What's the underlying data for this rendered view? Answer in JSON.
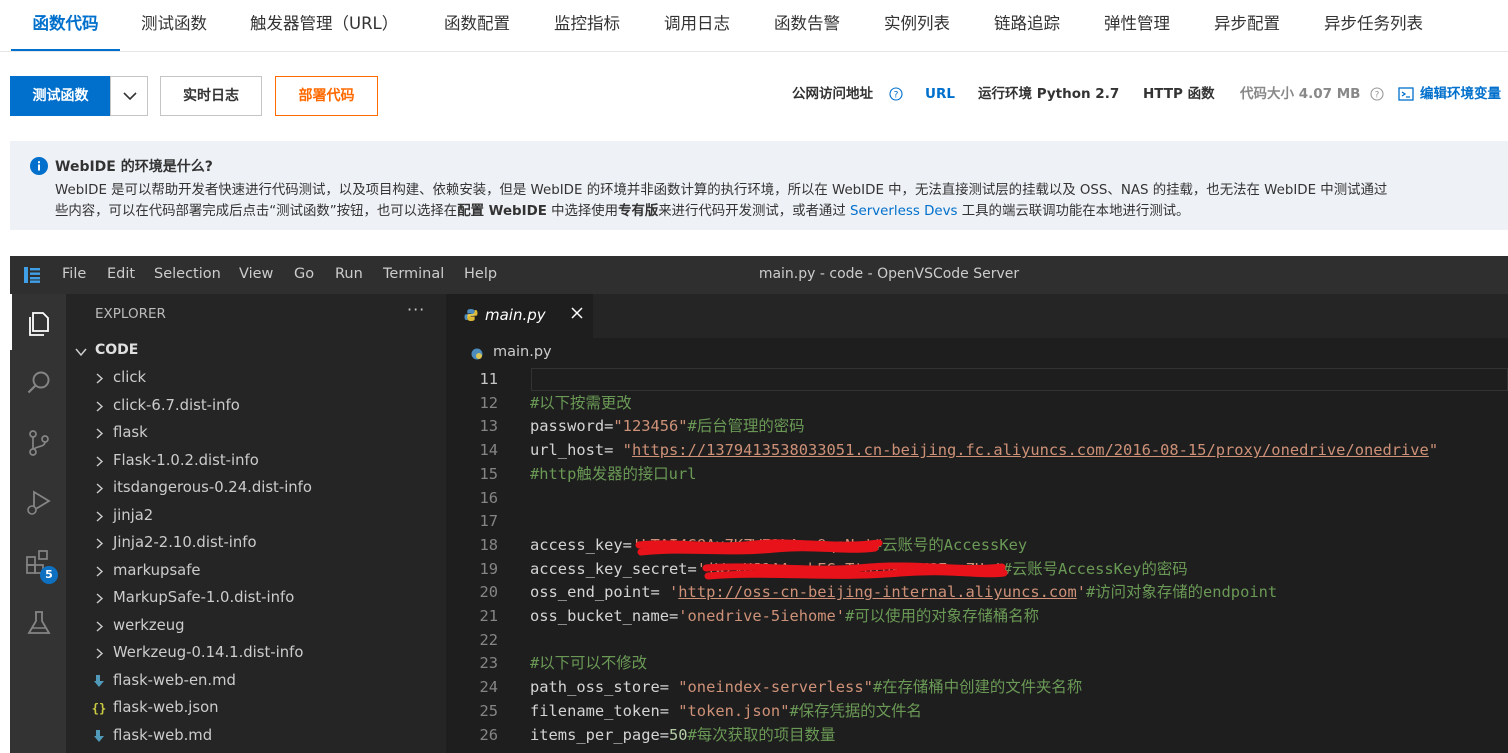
{
  "tabs": [
    {
      "label": "函数代码",
      "active": true
    },
    {
      "label": "测试函数"
    },
    {
      "label": "触发器管理（URL）"
    },
    {
      "label": "函数配置"
    },
    {
      "label": "监控指标"
    },
    {
      "label": "调用日志"
    },
    {
      "label": "函数告警"
    },
    {
      "label": "实例列表"
    },
    {
      "label": "链路追踪"
    },
    {
      "label": "弹性管理"
    },
    {
      "label": "异步配置"
    },
    {
      "label": "异步任务列表"
    }
  ],
  "toolbar": {
    "test_label": "测试函数",
    "realtime_log_label": "实时日志",
    "deploy_label": "部署代码",
    "public_url_label": "公网访问地址",
    "url_link": "URL",
    "runtime_label": "运行环境 Python 2.7",
    "http_label": "HTTP 函数",
    "code_size_label": "代码大小 4.07 MB",
    "edit_env_label": "编辑环境变量"
  },
  "notice": {
    "title": "WebIDE 的环境是什么?",
    "line1": "WebIDE 是可以帮助开发者快速进行代码测试，以及项目构建、依赖安装，但是 WebIDE 的环境并非函数计算的执行环境，所以在 WebIDE 中，无法直接测试层的挂载以及 OSS、NAS 的挂载，也无法在 WebIDE 中测试通过",
    "line2_a": "些内容，可以在代码部署完成后点击“测试函数”按钮，也可以选择在",
    "line2_b": "配置 WebIDE",
    "line2_c": " 中选择使用",
    "line2_d": "专有版",
    "line2_e": "来进行代码开发测试，或者通过 ",
    "line2_link": "Serverless Devs",
    "line2_f": " 工具的端云联调功能在本地进行测试。"
  },
  "vscode": {
    "menu": [
      "File",
      "Edit",
      "Selection",
      "View",
      "Go",
      "Run",
      "Terminal",
      "Help"
    ],
    "window_title": "main.py - code - OpenVSCode Server",
    "extensions_badge": "5",
    "explorer_title": "EXPLORER",
    "explorer_more": "···",
    "folder_name": "CODE",
    "tree": [
      {
        "label": "click",
        "type": "folder"
      },
      {
        "label": "click-6.7.dist-info",
        "type": "folder"
      },
      {
        "label": "flask",
        "type": "folder"
      },
      {
        "label": "Flask-1.0.2.dist-info",
        "type": "folder"
      },
      {
        "label": "itsdangerous-0.24.dist-info",
        "type": "folder"
      },
      {
        "label": "jinja2",
        "type": "folder"
      },
      {
        "label": "Jinja2-2.10.dist-info",
        "type": "folder"
      },
      {
        "label": "markupsafe",
        "type": "folder"
      },
      {
        "label": "MarkupSafe-1.0.dist-info",
        "type": "folder"
      },
      {
        "label": "werkzeug",
        "type": "folder"
      },
      {
        "label": "Werkzeug-0.14.1.dist-info",
        "type": "folder"
      },
      {
        "label": "flask-web-en.md",
        "type": "md"
      },
      {
        "label": "flask-web.json",
        "type": "json"
      },
      {
        "label": "flask-web.md",
        "type": "md"
      }
    ],
    "tab_name": "main.py",
    "breadcrumb": "main.py",
    "code": {
      "l11": {
        "n": "11"
      },
      "l12": {
        "n": "12",
        "comment": "#以下按需更改"
      },
      "l13": {
        "n": "13",
        "a": "password=",
        "s": "\"123456\"",
        "c": "#后台管理的密码"
      },
      "l14": {
        "n": "14",
        "a": "url_host= ",
        "q1": "\"",
        "url": "https://1379413538033051.cn-beijing.fc.aliyuncs.com/2016-08-15/proxy/onedrive/onedrive",
        "q2": "\""
      },
      "l15": {
        "n": "15",
        "comment": "#http触发器的接口url"
      },
      "l16": {
        "n": "16"
      },
      "l17": {
        "n": "17"
      },
      "l18": {
        "n": "18",
        "a": "access_key=",
        "s1": "'",
        "masked": "LTAI4G8Ax7KZWE2LAvz9qaNw",
        "s2": "'",
        "c": "#云账号的AccessKey"
      },
      "l19": {
        "n": "19",
        "a": "access_key_secret=",
        "s1": "'",
        "masked": "jWzyHJ1AAcghEGmTtqzgk3FUSFsmZUa",
        "s2": "'",
        "c": "#云账号AccessKey的密码"
      },
      "l20": {
        "n": "20",
        "a": "oss_end_point= ",
        "q1": "'",
        "url": "http://oss-cn-beijing-internal.aliyuncs.com",
        "q2": "'",
        "c": "#访问对象存储的endpoint"
      },
      "l21": {
        "n": "21",
        "a": "oss_bucket_name=",
        "s": "'onedrive-5iehome'",
        "c": "#可以使用的对象存储桶名称"
      },
      "l22": {
        "n": "22"
      },
      "l23": {
        "n": "23",
        "comment": "#以下可以不修改"
      },
      "l24": {
        "n": "24",
        "a": "path_oss_store= ",
        "s": "\"oneindex-serverless\"",
        "c": "#在存储桶中创建的文件夹名称"
      },
      "l25": {
        "n": "25",
        "a": "filename_token= ",
        "s": "\"token.json\"",
        "c": "#保存凭据的文件名"
      },
      "l26": {
        "n": "26",
        "a": "items_per_page=",
        "num": "50",
        "c": "#每次获取的项目数量"
      }
    }
  },
  "colors": {
    "accent": "#0070cc",
    "deploy": "#ff6a00",
    "editor_bg": "#1e1e1e",
    "comment": "#6a9955",
    "string": "#ce9178",
    "redact": "#e8121a"
  }
}
